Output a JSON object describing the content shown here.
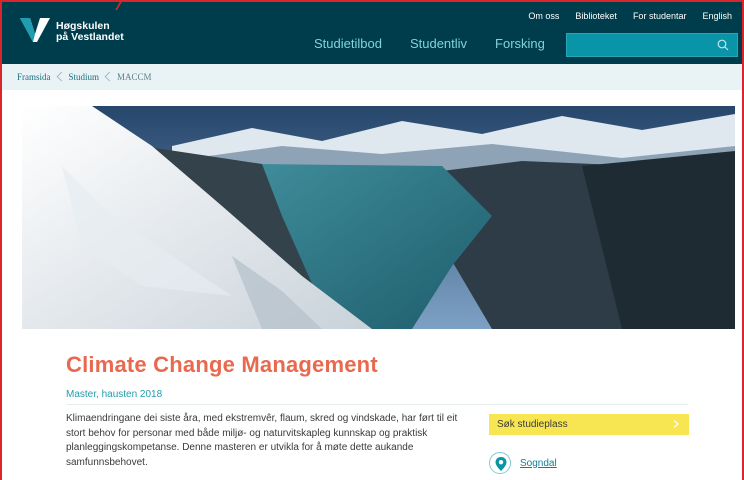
{
  "brand": {
    "line1": "Høgskulen",
    "line2": "på Vestlandet"
  },
  "utility_nav": [
    "Om oss",
    "Biblioteket",
    "For studentar",
    "English"
  ],
  "main_nav": [
    "Studietilbod",
    "Studentliv",
    "Forsking"
  ],
  "search": {
    "value": "",
    "placeholder": ""
  },
  "breadcrumb": [
    "Framsida",
    "Studium",
    "MACCM"
  ],
  "hero": {
    "icon": "fjord-landscape-photo"
  },
  "page": {
    "title": "Climate Change Management",
    "subtitle": "Master, hausten 2018",
    "intro": "Klimaendringane dei siste åra, med ekstremvêr, flaum, skred og vindskade, har ført til eit stort behov for personar med både miljø- og naturvitskapleg kunnskap og praktisk planleggingskompetanse. Denne masteren er utvikla for å møte dette aukande samfunnsbehovet."
  },
  "apply_button": {
    "label": "Søk studieplass"
  },
  "location": {
    "label": "Sogndal",
    "icon": "location-pin-icon"
  },
  "colors": {
    "header_bg": "#003d4c",
    "nav_text": "#7fd3de",
    "search_bg": "#0a94a8",
    "title": "#e8694e",
    "accent_teal": "#239dac",
    "apply_bg": "#f7e552",
    "frame": "#d9262c"
  }
}
